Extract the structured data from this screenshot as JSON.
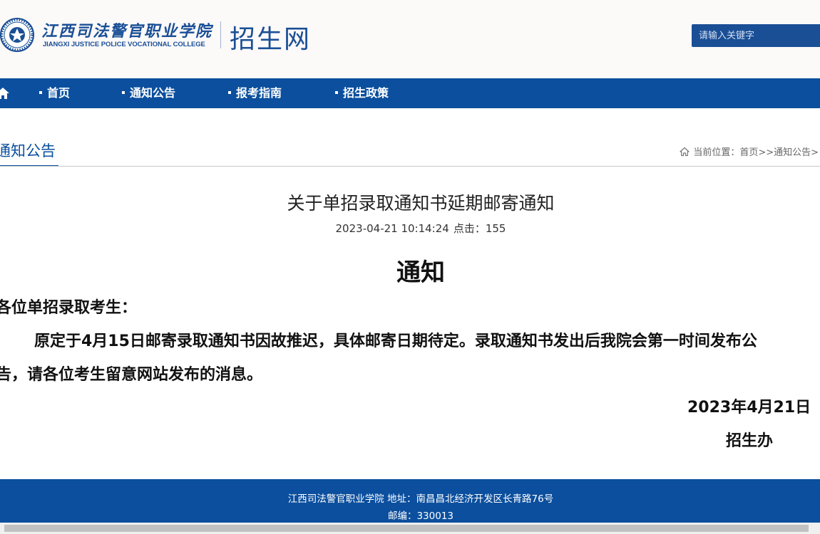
{
  "header": {
    "logo_cn": "江西司法警官职业学院",
    "logo_en": "JIANGXI JUSTICE POLICE VOCATIONAL COLLEGE",
    "site_name": "招生网",
    "search_placeholder": "请输入关键字",
    "brand_color": "#1a4f96"
  },
  "nav": {
    "home_icon": "home-icon",
    "items": [
      {
        "label": "首页"
      },
      {
        "label": "通知公告"
      },
      {
        "label": "报考指南"
      },
      {
        "label": "招生政策"
      }
    ],
    "color": "#0b4f9e"
  },
  "section": {
    "title": "通知公告",
    "breadcrumb": "当前位置：首页>>通知公告>"
  },
  "article": {
    "title": "关于单招录取通知书延期邮寄通知",
    "date": "2023-04-21 10:14:24",
    "clicks": "点击：155",
    "heading": "通知",
    "salutation": "各位单招录取考生：",
    "body_line_1": "原定于4月15日邮寄录取通知书因故推迟，具体邮寄日期待定。录取通知书发出后我院会第一时间发布公",
    "body_line_2": "告，请各位考生留意网站发布的消息。",
    "sign_date": "2023年4月21日",
    "sign_office": "招生办"
  },
  "footer": {
    "line_1": "江西司法警官职业学院 地址：南昌昌北经济开发区长青路76号",
    "line_2": "邮编：330013"
  }
}
